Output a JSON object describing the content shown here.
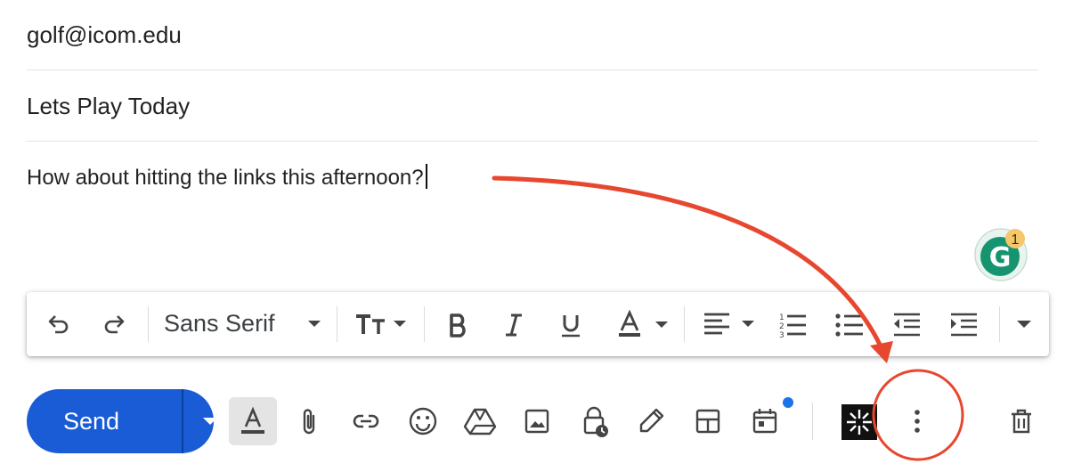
{
  "compose": {
    "to": "golf@icom.edu",
    "subject": "Lets Play Today",
    "body": "How about hitting the links this afternoon?"
  },
  "grammarly": {
    "count": "1",
    "letter": "G"
  },
  "toolbar": {
    "font": "Sans Serif"
  },
  "actions": {
    "send_label": "Send"
  },
  "colors": {
    "send": "#1a5bd6",
    "annotation": "#e8472f",
    "grammarly_green": "#15946f",
    "grammarly_badge": "#f6c66a"
  },
  "icons": [
    "undo-icon",
    "redo-icon",
    "font-dropdown-icon",
    "text-size-icon",
    "bold-icon",
    "italic-icon",
    "underline-icon",
    "text-color-icon",
    "align-icon",
    "numbered-list-icon",
    "bulleted-list-icon",
    "indent-less-icon",
    "indent-more-icon",
    "more-formatting-icon",
    "formatting-options-icon",
    "attach-icon",
    "link-icon",
    "emoji-icon",
    "drive-icon",
    "photo-icon",
    "confidential-icon",
    "signature-icon",
    "template-icon",
    "schedule-icon",
    "more-options-icon",
    "trash-icon"
  ]
}
